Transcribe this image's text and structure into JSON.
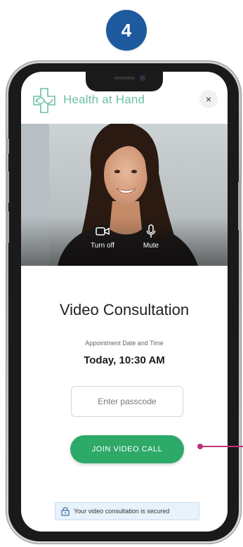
{
  "step": {
    "number": "4"
  },
  "app": {
    "name": "Health at Hand",
    "logo_icon": "cross-logo-icon",
    "close_glyph": "×",
    "brand_color": "#6dbfa5"
  },
  "video": {
    "camera_control": {
      "icon": "video-camera-icon",
      "label": "Turn off"
    },
    "mic_control": {
      "icon": "microphone-icon",
      "label": "Mute"
    }
  },
  "consultation": {
    "title": "Video Consultation",
    "appointment_label": "Appointment Date and Time",
    "appointment_time": "Today, 10:30 AM",
    "passcode_placeholder": "Enter passcode",
    "passcode_value": "",
    "join_button_label": "JOIN VIDEO CALL",
    "join_button_color": "#2da968"
  },
  "security": {
    "icon": "lock-icon",
    "text": "Your video consultation is secured"
  },
  "colors": {
    "step_badge": "#1d5a9e",
    "callout": "#c0307a"
  }
}
